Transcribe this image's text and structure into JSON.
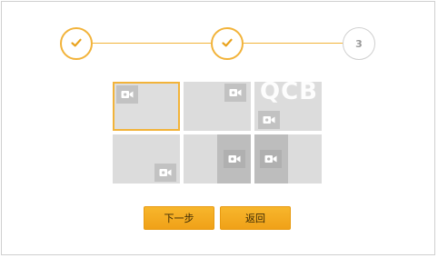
{
  "stepper": {
    "steps": [
      {
        "state": "done",
        "icon": "check-icon"
      },
      {
        "state": "done",
        "icon": "check-icon"
      },
      {
        "state": "pending",
        "label": "3"
      }
    ]
  },
  "layout_grid": {
    "watermark": "QCB",
    "camera_icon": "video-camera-icon"
  },
  "buttons": {
    "next_label": "下一步",
    "back_label": "返回"
  },
  "colors": {
    "accent": "#f2b33a",
    "cell": "#dcdcdc",
    "camera_badge": "#c2c2c2"
  }
}
